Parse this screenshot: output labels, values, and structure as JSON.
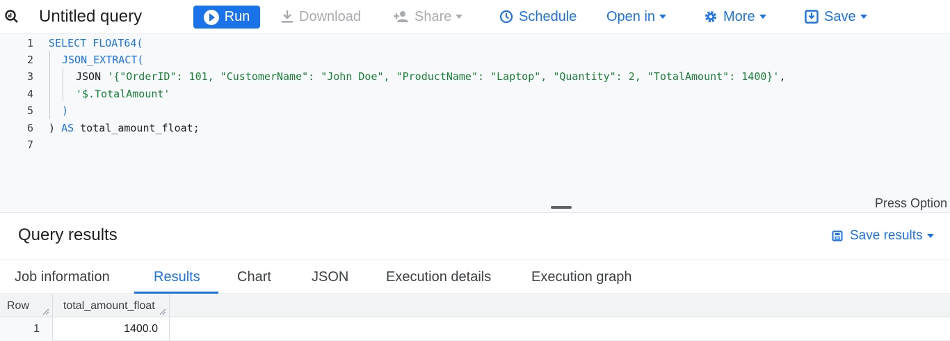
{
  "toolbar": {
    "title": "Untitled query",
    "run_label": "Run",
    "download_label": "Download",
    "share_label": "Share",
    "schedule_label": "Schedule",
    "open_in_label": "Open in",
    "more_label": "More",
    "save_label": "Save"
  },
  "editor": {
    "line_numbers": [
      "1",
      "2",
      "3",
      "4",
      "5",
      "6",
      "7"
    ],
    "lines": [
      {
        "kw": "SELECT FLOAT64(",
        "rest": ""
      },
      {
        "kw": "JSON_EXTRACT(",
        "rest": ""
      },
      {
        "plain": "JSON ",
        "str": "'{\"OrderID\": 101, \"CustomerName\": \"John Doe\", \"ProductName\": \"Laptop\", \"Quantity\": 2, \"TotalAmount\": 1400}'",
        "tail": ","
      },
      {
        "str": "'$.TotalAmount'"
      },
      {
        "kw": ")"
      },
      {
        "plain_a": ") ",
        "kw": "AS",
        "plain_b": " total_amount_float;"
      },
      {}
    ]
  },
  "splitter": {
    "hint": "Press Option"
  },
  "results": {
    "title": "Query results",
    "save_results_label": "Save results",
    "tabs": [
      "Job information",
      "Results",
      "Chart",
      "JSON",
      "Execution details",
      "Execution graph"
    ],
    "active_tab": "Results",
    "columns": [
      "Row",
      "total_amount_float"
    ],
    "rows": [
      [
        "1",
        "1400.0"
      ]
    ]
  },
  "colors": {
    "accent": "#1a73e8",
    "keyword": "#1a73e8",
    "string": "#188038",
    "disabled": "#a8abaf"
  }
}
